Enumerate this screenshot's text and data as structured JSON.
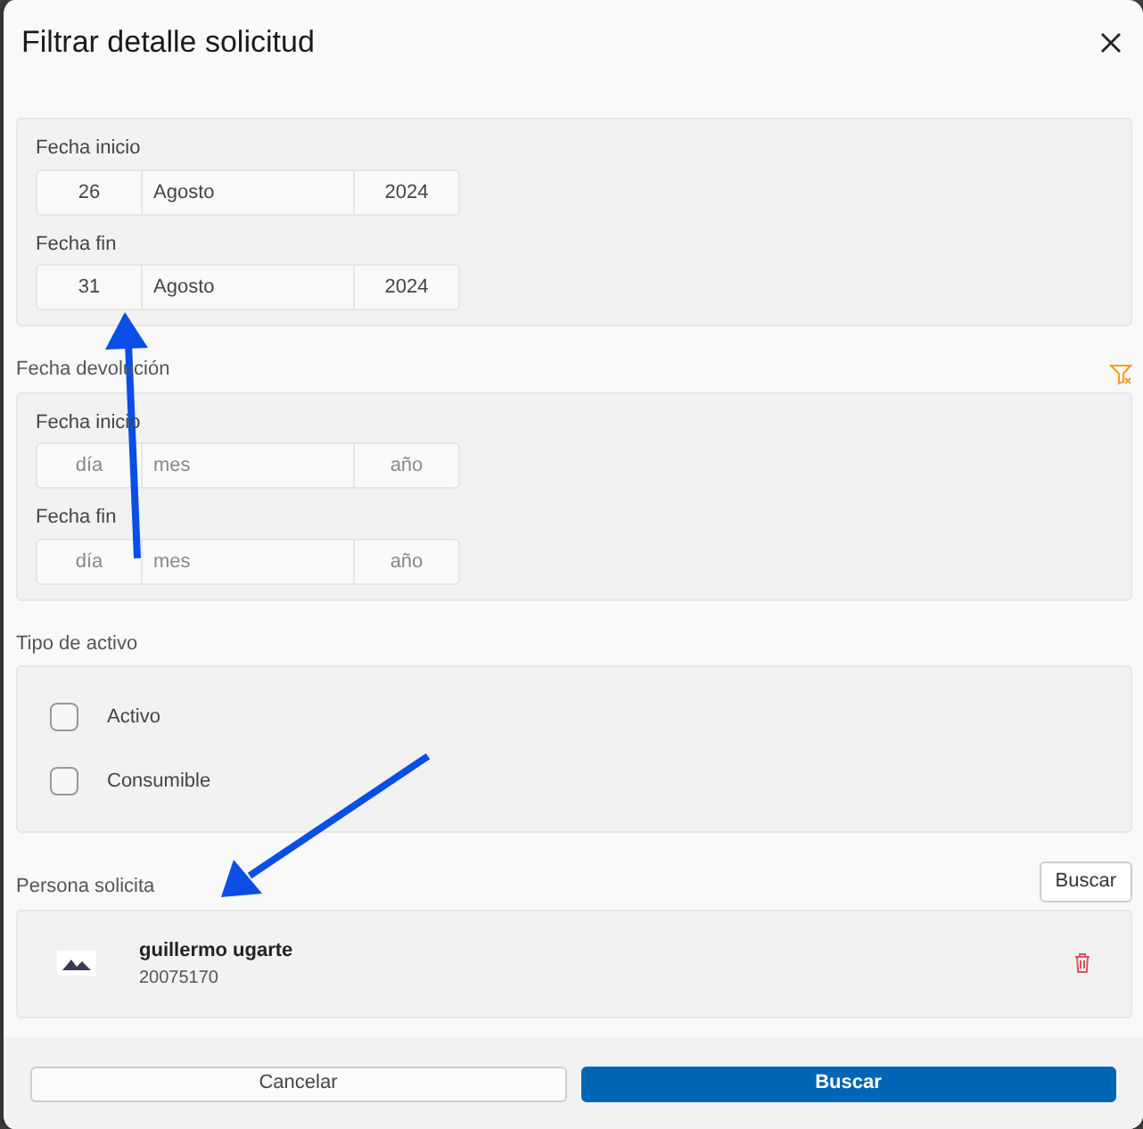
{
  "dialog": {
    "title": "Filtrar detalle solicitud"
  },
  "sections": [
    {
      "kind": "dates",
      "filter_icon": false,
      "fields": [
        {
          "label": "Fecha inicio",
          "day": {
            "value": "26"
          },
          "month": {
            "value": "Agosto"
          },
          "year": {
            "value": "2024"
          }
        },
        {
          "label": "Fecha fin",
          "day": {
            "value": "31"
          },
          "month": {
            "value": "Agosto"
          },
          "year": {
            "value": "2024"
          }
        }
      ]
    },
    {
      "kind": "dates",
      "label": "Fecha devolución",
      "filter_icon": true,
      "fields": [
        {
          "label": "Fecha inicio",
          "day": {
            "placeholder": "día"
          },
          "month": {
            "placeholder": "mes"
          },
          "year": {
            "placeholder": "año"
          }
        },
        {
          "label": "Fecha fin",
          "day": {
            "placeholder": "día"
          },
          "month": {
            "placeholder": "mes"
          },
          "year": {
            "placeholder": "año"
          }
        }
      ]
    },
    {
      "kind": "checks",
      "label": "Tipo de activo",
      "items": [
        {
          "label": "Activo",
          "checked": false
        },
        {
          "label": "Consumible",
          "checked": false
        }
      ]
    },
    {
      "kind": "person",
      "label": "Persona solicita",
      "button": "Buscar",
      "person": {
        "name": "guillermo ugarte",
        "code": "20075170"
      }
    }
  ],
  "footer": {
    "buttons": [
      {
        "label": "Cancelar",
        "kind": "secondary"
      },
      {
        "label": "Buscar",
        "kind": "primary"
      }
    ]
  }
}
